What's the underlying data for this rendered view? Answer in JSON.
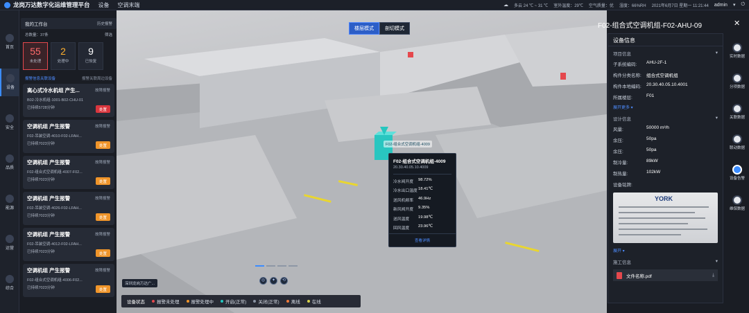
{
  "header": {
    "app_title": "龙岗万达数字化运维管理平台",
    "nav": [
      "设备",
      "空调末端"
    ],
    "weather": "多云 24 ℃ ~ 31 ℃",
    "outdoor_temp": "室外温度：29℃",
    "air_quality": "空气质量：优",
    "humidity": "湿度：66%RH",
    "datetime": "2021年6月7日 星期一 11:21:44",
    "user": "admin"
  },
  "leftnav": [
    {
      "label": "首页",
      "icon": "home-icon"
    },
    {
      "label": "设备",
      "icon": "device-icon"
    },
    {
      "label": "安全",
      "icon": "shield-icon"
    },
    {
      "label": "品质",
      "icon": "quality-icon"
    },
    {
      "label": "能源",
      "icon": "energy-icon"
    },
    {
      "label": "运营",
      "icon": "operation-icon"
    },
    {
      "label": "综合",
      "icon": "overview-icon"
    }
  ],
  "alarm_panel": {
    "title": "我的工作台",
    "history": "历史报警",
    "online": "总数量：37条",
    "filter": "筛选",
    "stats": [
      {
        "value": "55",
        "label": "未处理"
      },
      {
        "value": "2",
        "label": "处理中"
      },
      {
        "value": "9",
        "label": "已恢复"
      }
    ],
    "tab_active": "报警信息关联设备",
    "tab_inactive": "报警关联周边设备",
    "cards": [
      {
        "title": "离心式冷水机组 产生...",
        "level": "故障报警",
        "desc": "B02-冷水机组-1001-B02-CHU-01",
        "time": "已持续5728分钟",
        "button": "处置"
      },
      {
        "title": "空调机组 产生报警",
        "level": "故障报警",
        "desc": "F02-吊装空调-4010-F02-LFAH...",
        "time": "已持续7023分钟",
        "button": "处置"
      },
      {
        "title": "空调机组 产生报警",
        "level": "故障报警",
        "desc": "F02-组合式空调机组-4007-F02...",
        "time": "已持续7023分钟",
        "button": "处置"
      },
      {
        "title": "空调机组 产生报警",
        "level": "故障报警",
        "desc": "F02-吊装空调-4026-F02-LFAH...",
        "time": "已持续7023分钟",
        "button": "处置"
      },
      {
        "title": "空调机组 产生报警",
        "level": "故障报警",
        "desc": "F02-吊装空调-4012-F02-LFAH...",
        "time": "已持续7023分钟",
        "button": "处置"
      },
      {
        "title": "空调机组 产生报警",
        "level": "故障报警",
        "desc": "F02-组合式空调机组-4006-F02...",
        "time": "已持续7023分钟",
        "button": "处置"
      }
    ]
  },
  "scene": {
    "mode_tabs": [
      "楼层模式",
      "剖切模式"
    ],
    "device_label": "F02-组合式空调机组-4009",
    "popup": {
      "title": "F02-组合式空调机组-4009",
      "code": "20.30.40.05.10.4009",
      "rows": [
        {
          "k": "冷水阀开度",
          "v": "98.72%"
        },
        {
          "k": "冷水出口温度",
          "v": "18.41℃"
        },
        {
          "k": "送风机频率",
          "v": "46.9Hz"
        },
        {
          "k": "新风阀开度",
          "v": "9.35%"
        },
        {
          "k": "送风温度",
          "v": "19.98℃"
        },
        {
          "k": "回风温度",
          "v": "23.96℃"
        }
      ],
      "link": "查看详情"
    },
    "bottom_tag": "深圳龙岗万达广...",
    "legend": {
      "title": "设备状态",
      "items": [
        {
          "label": "报警未处理",
          "color": "#e5484d"
        },
        {
          "label": "报警处理中",
          "color": "#f0952a"
        },
        {
          "label": "开启(正常)",
          "color": "#22c7c0"
        },
        {
          "label": "关闭(正常)",
          "color": "#8a93a3"
        },
        {
          "label": "离线",
          "color": "#f07a3a"
        },
        {
          "label": "在线",
          "color": "#d9d34a"
        }
      ]
    }
  },
  "right_panel": {
    "device_title": "F02-组合式空调机组-F02-AHU-09",
    "title": "设备信息",
    "project_section": "项目信息",
    "project": [
      {
        "k": "子系统编码:",
        "v": "AHU-2F-1"
      },
      {
        "k": "构件分类名称:",
        "v": "组合式空调机组"
      },
      {
        "k": "构件本地编码:",
        "v": "20.30.40.05.10.4001"
      },
      {
        "k": "所属楼层:",
        "v": "F01"
      }
    ],
    "more": "展开更多 ▾",
    "design_section": "设计信息",
    "design": [
      {
        "k": "风量:",
        "v": "50000 m³/h"
      },
      {
        "k": "余压:",
        "v": "50pa"
      },
      {
        "k": "余压:",
        "v": "50pa"
      },
      {
        "k": "制冷量:",
        "v": "89kW"
      },
      {
        "k": "制热量:",
        "v": "102kW"
      }
    ],
    "nameplate_label": "设备铭牌:",
    "nameplate_brand": "YORK",
    "collapse": "展开 ▾",
    "construction_section": "施工信息",
    "file": "文件名称.pdf"
  },
  "rightnav": [
    {
      "label": "实时数据"
    },
    {
      "label": "分项数据"
    },
    {
      "label": "关联数据"
    },
    {
      "label": "联动数据"
    },
    {
      "label": "设备告警"
    },
    {
      "label": "维保数据"
    }
  ]
}
